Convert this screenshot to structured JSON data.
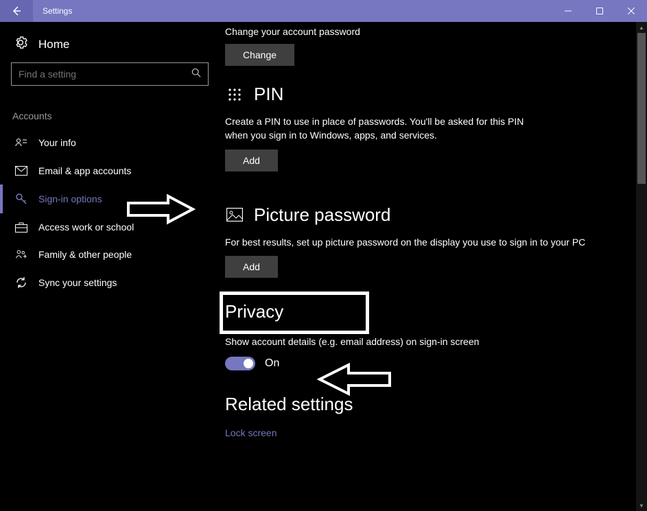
{
  "window": {
    "title": "Settings"
  },
  "sidebar": {
    "home": "Home",
    "search_placeholder": "Find a setting",
    "category": "Accounts",
    "items": [
      {
        "label": "Your info"
      },
      {
        "label": "Email & app accounts"
      },
      {
        "label": "Sign-in options"
      },
      {
        "label": "Access work or school"
      },
      {
        "label": "Family & other people"
      },
      {
        "label": "Sync your settings"
      }
    ]
  },
  "content": {
    "password": {
      "desc": "Change your account password",
      "button": "Change"
    },
    "pin": {
      "heading": "PIN",
      "desc": "Create a PIN to use in place of passwords. You'll be asked for this PIN when you sign in to Windows, apps, and services.",
      "button": "Add"
    },
    "picture": {
      "heading": "Picture password",
      "desc": "For best results, set up picture password on the display you use to sign in to your PC",
      "button": "Add"
    },
    "privacy": {
      "heading": "Privacy",
      "toggle_label": "Show account details (e.g. email address) on sign-in screen",
      "toggle_state": "On"
    },
    "related": {
      "heading": "Related settings",
      "link": "Lock screen"
    }
  }
}
